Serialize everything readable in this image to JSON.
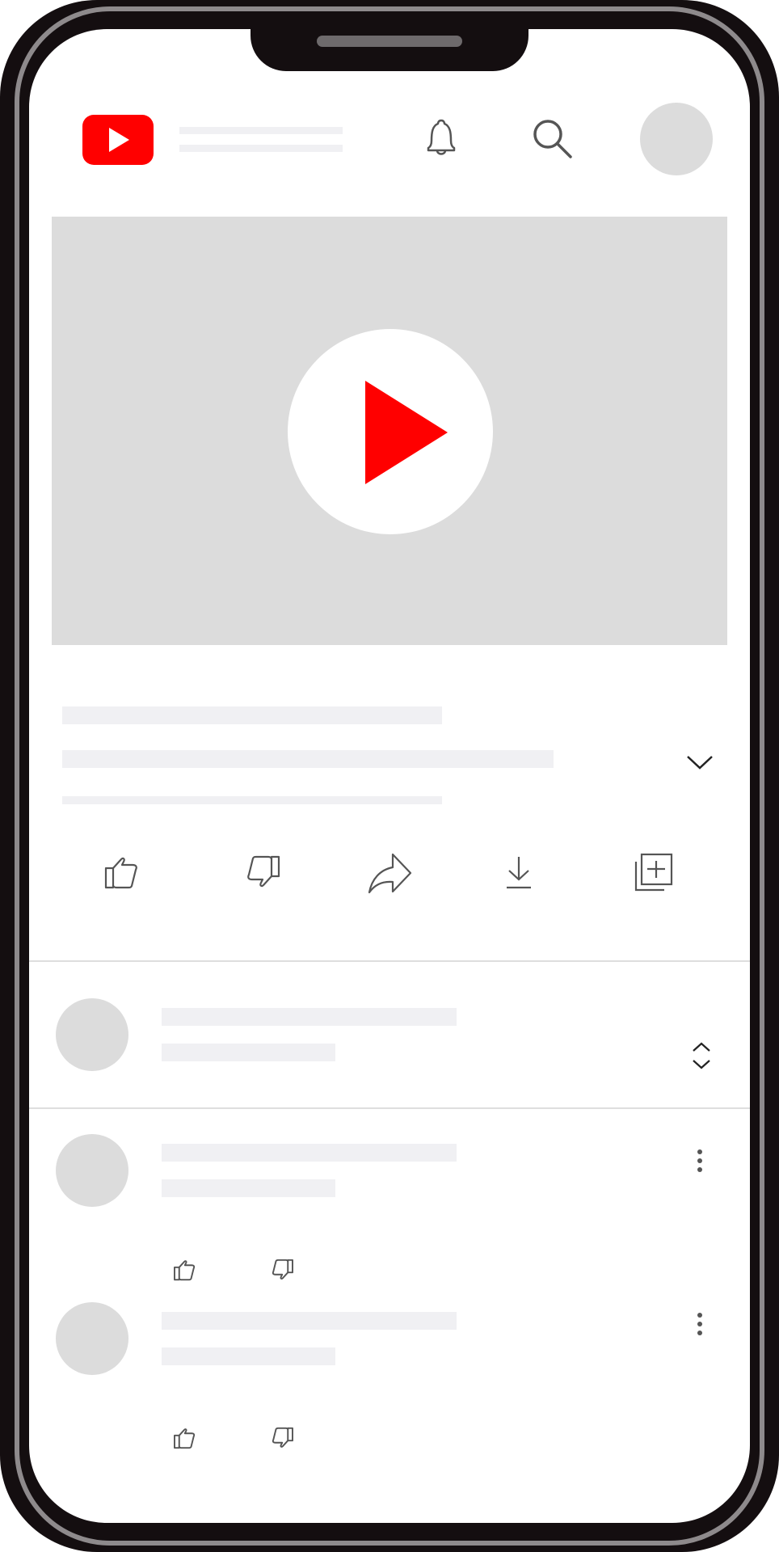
{
  "app": {
    "name": "YouTube",
    "brand_color": "#ff0000",
    "placeholder_color": "#dcdcdc",
    "skeleton_color": "#f0f0f3",
    "frame_color": "#140e10"
  },
  "header": {
    "logo_icon": "youtube-logo-icon",
    "notification_icon": "bell-icon",
    "search_icon": "search-icon",
    "avatar": "account-avatar"
  },
  "player": {
    "play_icon": "play-icon"
  },
  "video_info": {
    "expand_icon": "chevron-down-icon"
  },
  "actions": [
    {
      "icon": "thumbs-up-icon"
    },
    {
      "icon": "thumbs-down-icon"
    },
    {
      "icon": "share-icon"
    },
    {
      "icon": "download-icon"
    },
    {
      "icon": "save-to-playlist-icon"
    }
  ],
  "comments_header": {
    "sort_icon": "expand-collapse-icon"
  },
  "comments": [
    {
      "avatar": "commenter-avatar",
      "menu_icon": "more-vertical-icon",
      "like_icon": "thumbs-up-icon",
      "dislike_icon": "thumbs-down-icon"
    },
    {
      "avatar": "commenter-avatar",
      "menu_icon": "more-vertical-icon",
      "like_icon": "thumbs-up-icon",
      "dislike_icon": "thumbs-down-icon"
    }
  ]
}
